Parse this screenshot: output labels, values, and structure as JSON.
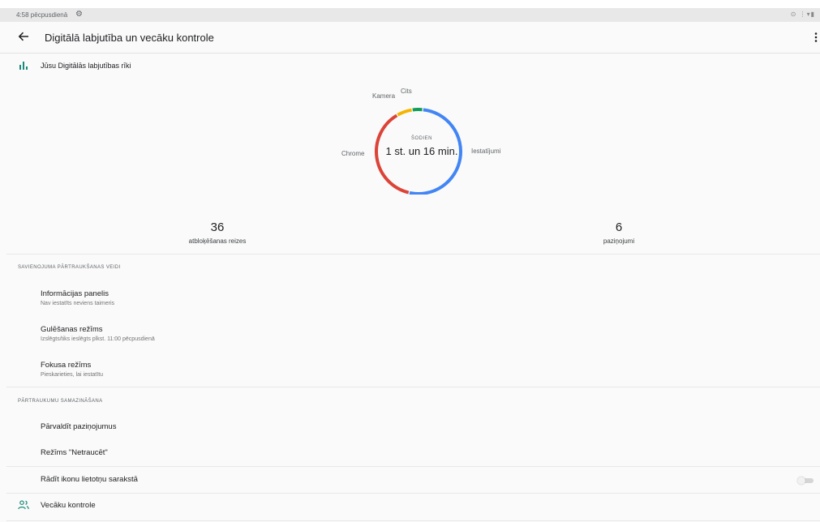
{
  "status_bar": {
    "time": "4:58 pēcpusdienā",
    "icons": "⊙ ⋮▾▮"
  },
  "app_bar": {
    "title": "Digitālā labjutība un vecāku kontrole"
  },
  "wellbeing": {
    "label": "Jūsu Digitālās labjutības rīki"
  },
  "usage_chart": {
    "today_label": "ŠODIEN",
    "total": "1 st. un 16 min.",
    "segments": [
      {
        "label": "Iestatījumi",
        "color": "#4285f4",
        "fraction": 0.52
      },
      {
        "label": "Chrome",
        "color": "#db4437",
        "fraction": 0.38
      },
      {
        "label": "Kamera",
        "color": "#f4b400",
        "fraction": 0.06
      },
      {
        "label": "Cits",
        "color": "#0f9d58",
        "fraction": 0.04
      }
    ]
  },
  "stats": {
    "unlocks_value": "36",
    "unlocks_label": "atbloķēšanas reizes",
    "notifications_value": "6",
    "notifications_label": "paziņojumi"
  },
  "disconnect_section": {
    "heading": "SAVIENOJUMA PĀRTRAUKŠANAS VEIDI",
    "items": [
      {
        "title": "Informācijas panelis",
        "subtitle": "Nav iestatīts neviens taimeris"
      },
      {
        "title": "Gulēšanas režīms",
        "subtitle": "Izslēgts/tiks ieslēgts plkst. 11:00 pēcpusdienā"
      },
      {
        "title": "Fokusa režīms",
        "subtitle": "Pieskarieties, lai iestatītu"
      }
    ]
  },
  "interruptions_section": {
    "heading": "PĀRTRAUKUMU SAMAZINĀŠANA",
    "items": [
      {
        "title": "Pārvaldīt paziņojumus"
      },
      {
        "title": "Režīms \"Netraucēt\""
      }
    ]
  },
  "show_icon_row": {
    "title": "Rādīt ikonu lietotņu sarakstā",
    "toggle_on": false
  },
  "parental": {
    "title": "Vecāku kontrole"
  },
  "colors": {
    "accent": "#1a8a7a",
    "blue": "#4285f4",
    "red": "#db4437",
    "yellow": "#f4b400",
    "green": "#0f9d58"
  }
}
